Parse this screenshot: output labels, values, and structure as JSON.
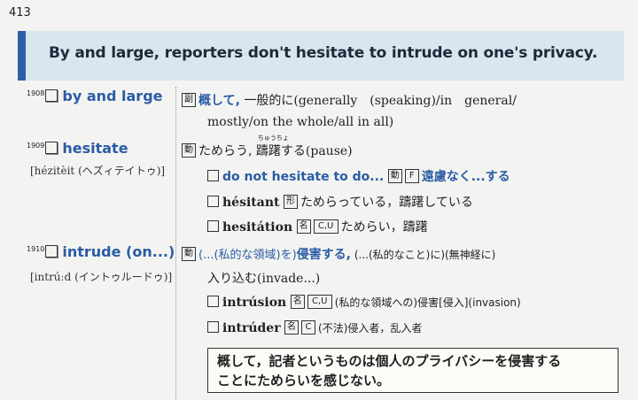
{
  "page": {
    "number": "413"
  },
  "banner": {
    "sentence": "By and large, reporters don't hesitate to intrude on one's privacy."
  },
  "entries": [
    {
      "num": "1908",
      "headword": "by and large",
      "pos": "副",
      "meaning_bold": "概して,",
      "meaning_line1_rest": " 一般的に(generally　(speaking)/in　general/",
      "meaning_line2": "mostly/on the whole/all in all)"
    },
    {
      "num": "1909",
      "headword": "hesitate",
      "pron": "[hézitèit (ヘズィテイトゥ)]",
      "pos": "動",
      "meaning_prefix": "ためらう, ",
      "ruby_base": "躊躇",
      "ruby_text": "ちゅうちょ",
      "meaning_suffix": "する(pause)",
      "derivs": [
        {
          "phrase": "do not hesitate to do...",
          "tag1": "動",
          "tag2": "F",
          "meaning": "遠慮なく...する"
        },
        {
          "word": "hésitant",
          "tag": "形",
          "meaning": "ためらっている，躊躇している"
        },
        {
          "word": "hesitátion",
          "tag": "名",
          "tag2": "C,U",
          "meaning": "ためらい，躊躇"
        }
      ]
    },
    {
      "num": "1910",
      "headword": "intrude (on...)",
      "pron": "[intrúːd (イントゥルードゥ)]",
      "pos": "動",
      "meaning_light1": "(...(私的な領域)を)",
      "meaning_bold": "侵害する,",
      "meaning_rest": " (...(私的なこと)に)(無神経に)",
      "meaning_line2": "入り込む(invade...)",
      "derivs": [
        {
          "word": "intrúsion",
          "tag": "名",
          "tag2": "C,U",
          "meaning": "(私的な領域への)侵害[侵入](invasion)"
        },
        {
          "word": "intrúder",
          "tag": "名",
          "tag2": "C",
          "meaning": "(不法)侵入者，乱入者"
        }
      ]
    }
  ],
  "translation": {
    "line1": "概して，記者というものは個人のプライバシーを侵害する",
    "line2": "ことにためらいを感じない。"
  }
}
